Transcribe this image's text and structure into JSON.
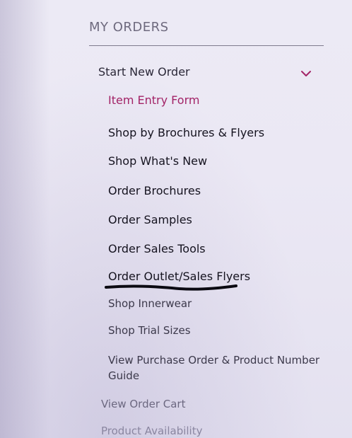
{
  "section": {
    "title": "MY ORDERS"
  },
  "start_new_order": {
    "label": "Start New Order",
    "expanded": true,
    "chevron_icon": "chevron-down-icon",
    "chevron_color": "#a32467",
    "items": [
      {
        "label": "Item Entry Form",
        "active": true
      },
      {
        "label": "Shop by Brochures & Flyers"
      },
      {
        "label": "Shop What's New"
      },
      {
        "label": "Order Brochures"
      },
      {
        "label": "Order Samples"
      },
      {
        "label": "Order Sales Tools"
      },
      {
        "label": "Order Outlet/Sales Flyers",
        "underlined_by_marker": true
      },
      {
        "label": "Shop Innerwear"
      },
      {
        "label": "Shop Trial Sizes"
      },
      {
        "label": "View Purchase Order & Product Number Guide"
      }
    ]
  },
  "other_links": [
    {
      "label": "View Order Cart"
    },
    {
      "label": "Product Availability"
    }
  ],
  "colors": {
    "active_link": "#a32467",
    "link": "#15131f",
    "secondary_link": "#6c6880",
    "background": "#ebe8f4"
  }
}
